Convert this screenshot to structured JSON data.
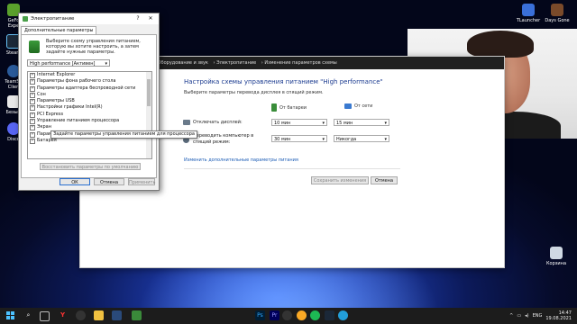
{
  "desktop": {
    "icons_left": [
      {
        "label": "GeFo\nExpe"
      },
      {
        "label": "Steam"
      },
      {
        "label": "TeamSp\nClien"
      },
      {
        "label": "Безым"
      },
      {
        "label": "Disco"
      }
    ],
    "icons_right": [
      {
        "label": "TLauncher"
      },
      {
        "label": "Days Gone"
      },
      {
        "label": "Корзина"
      }
    ]
  },
  "plan_window": {
    "breadcrumb": [
      "Оборудование и звук",
      "Электропитание",
      "Изменение параметров схемы"
    ],
    "heading": "Настройка схемы управления питанием \"High performance\"",
    "subtitle": "Выберите параметры перевода дисплея в спящий режим.",
    "col_battery": "От батареи",
    "col_power": "От сети",
    "rows": [
      {
        "label": "Отключать дисплей:",
        "battery": "10 мин",
        "power": "15 мин"
      },
      {
        "label": "Переводить компьютер в спящий режим:",
        "battery": "30 мин",
        "power": "Никогда"
      }
    ],
    "advanced_link": "Изменить дополнительные параметры питания",
    "save_button": "Сохранить изменения",
    "cancel_button": "Отмена"
  },
  "dialog": {
    "title": "Электропитание",
    "close_glyph": "✕",
    "help_glyph": "?",
    "tab": "Дополнительные параметры",
    "intro": "Выберите схему управления питанием, которую вы хотите настроить, а затем задайте нужные параметры.",
    "plan_select": "High performance [Активен]",
    "tree_items": [
      "Internet Explorer",
      "Параметры фона рабочего стола",
      "Параметры адаптера беспроводной сети",
      "Сон",
      "Параметры USB",
      "Настройки графики Intel(R)",
      "PCI Express",
      "Управление питанием процессора",
      "Экран",
      "Параметры мультимедиа",
      "Батарея"
    ],
    "restore_button": "Восстановить параметры по умолчанию",
    "ok_button": "ОК",
    "cancel_button": "Отмена",
    "apply_button": "Применить",
    "tooltip": "Задайте параметры управления питанием для процессора"
  },
  "taskbar": {
    "lang": "ENG",
    "time": "14:47",
    "date": "19.08.2021"
  }
}
